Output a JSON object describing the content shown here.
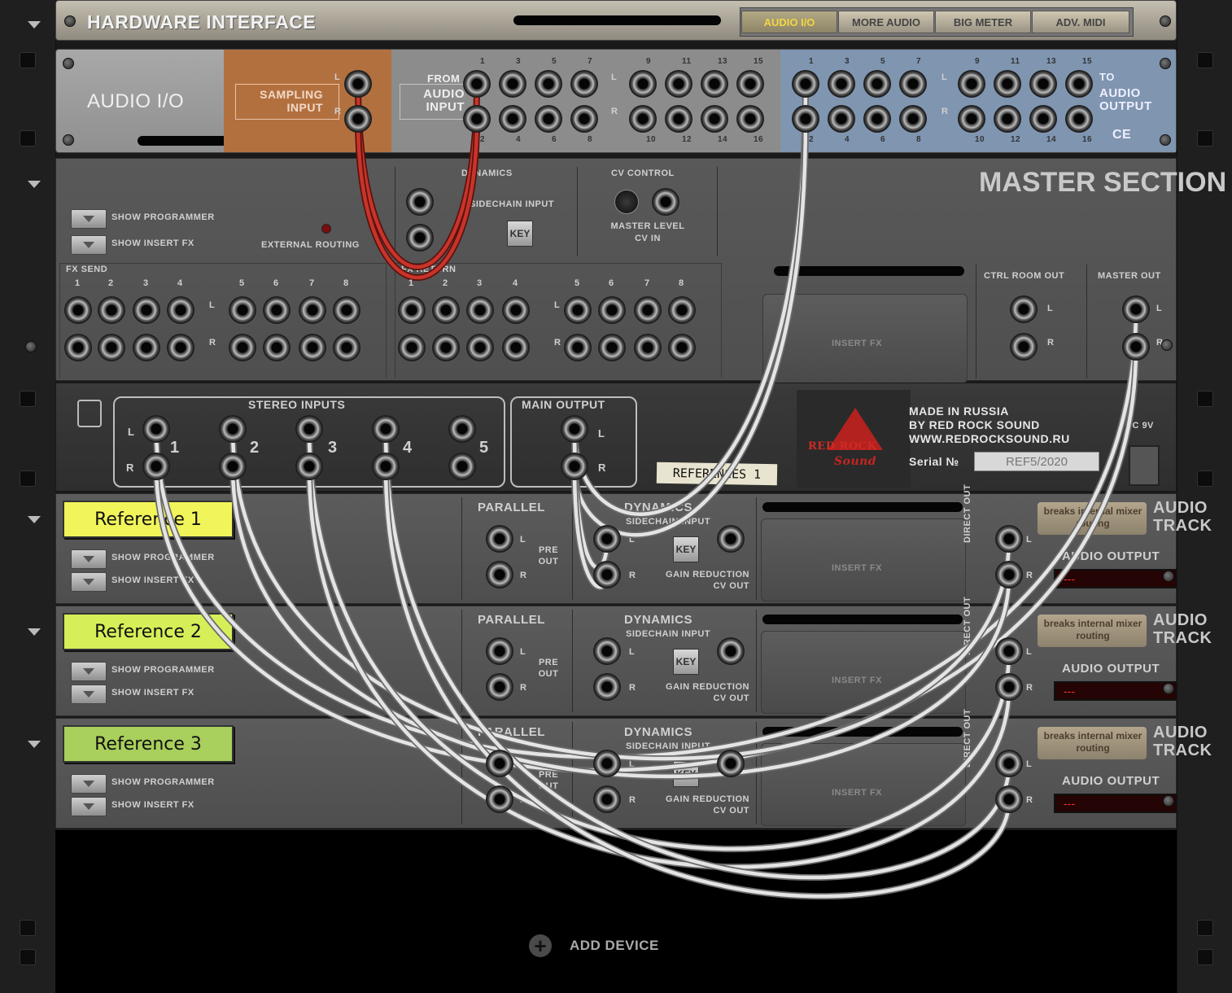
{
  "hardware_interface": {
    "title": "HARDWARE INTERFACE",
    "tabs": [
      "AUDIO I/O",
      "MORE AUDIO",
      "BIG METER",
      "ADV. MIDI"
    ],
    "active_tab": "AUDIO I/O"
  },
  "audio_io": {
    "title": "AUDIO I/O",
    "sampling_input": "SAMPLING INPUT",
    "from_label": "FROM",
    "audio_input": "AUDIO INPUT",
    "to_label": "TO",
    "audio_output": "AUDIO OUTPUT",
    "ce_mark": "CE",
    "channels_odd": [
      "1",
      "3",
      "5",
      "7",
      "9",
      "11",
      "13",
      "15"
    ],
    "channels_even": [
      "2",
      "4",
      "6",
      "8",
      "10",
      "12",
      "14",
      "16"
    ],
    "left": "L",
    "right": "R"
  },
  "master_section": {
    "title": "MASTER SECTION",
    "show_programmer": "SHOW PROGRAMMER",
    "show_insert_fx": "SHOW INSERT FX",
    "external_routing": "EXTERNAL ROUTING",
    "dynamics": "DYNAMICS",
    "sidechain_input": "SIDECHAIN INPUT",
    "key": "KEY",
    "cv_control": "CV CONTROL",
    "master_level_cv": "MASTER LEVEL CV IN",
    "fx_send": "FX SEND",
    "fx_return": "FX RETURN",
    "fx_numbers": [
      "1",
      "2",
      "3",
      "4",
      "5",
      "6",
      "7",
      "8"
    ],
    "insert_fx": "INSERT FX",
    "ctrl_room_out": "CTRL ROOM OUT",
    "master_out": "MASTER OUT",
    "left": "L",
    "right": "R"
  },
  "reference_device": {
    "stereo_inputs": "STEREO INPUTS",
    "main_output": "MAIN OUTPUT",
    "input_numbers": [
      "1",
      "2",
      "3",
      "4",
      "5"
    ],
    "tape_label": "REFERENCES 1",
    "brand_line1": "RED ROCK",
    "brand_line2": "Sound",
    "made_in_1": "MADE IN RUSSIA",
    "made_in_2": "BY RED ROCK SOUND",
    "made_in_3": "WWW.REDROCKSOUND.RU",
    "serial_label": "Serial №",
    "serial_value": "REF5/2020",
    "dc": "DC 9V",
    "left": "L",
    "right": "R"
  },
  "tracks": [
    {
      "name": "Reference 1",
      "color": "#f2f55a"
    },
    {
      "name": "Reference 2",
      "color": "#d6ef58"
    },
    {
      "name": "Reference 3",
      "color": "#a9cf5c"
    }
  ],
  "track_labels": {
    "show_programmer": "SHOW PROGRAMMER",
    "show_insert_fx": "SHOW INSERT FX",
    "parallel": "PARALLEL",
    "pre_out": "PRE OUT",
    "dynamics": "DYNAMICS",
    "sidechain_input": "SIDECHAIN INPUT",
    "key": "KEY",
    "gain_reduction": "GAIN REDUCTION CV OUT",
    "insert_fx": "INSERT FX",
    "direct_out": "DIRECT OUT",
    "breaks_routing": "breaks internal mixer routing",
    "audio_track": "AUDIO TRACK",
    "audio_output": "AUDIO OUTPUT",
    "output_value": "---",
    "left": "L",
    "right": "R"
  },
  "add_device": "ADD DEVICE",
  "colors": {
    "panel_gray": "#5a5a5a",
    "sampling_orange": "#b3703f",
    "output_blue": "#7f95b0",
    "cable_red": "#c8342a",
    "cable_white": "#e4e4e4"
  }
}
